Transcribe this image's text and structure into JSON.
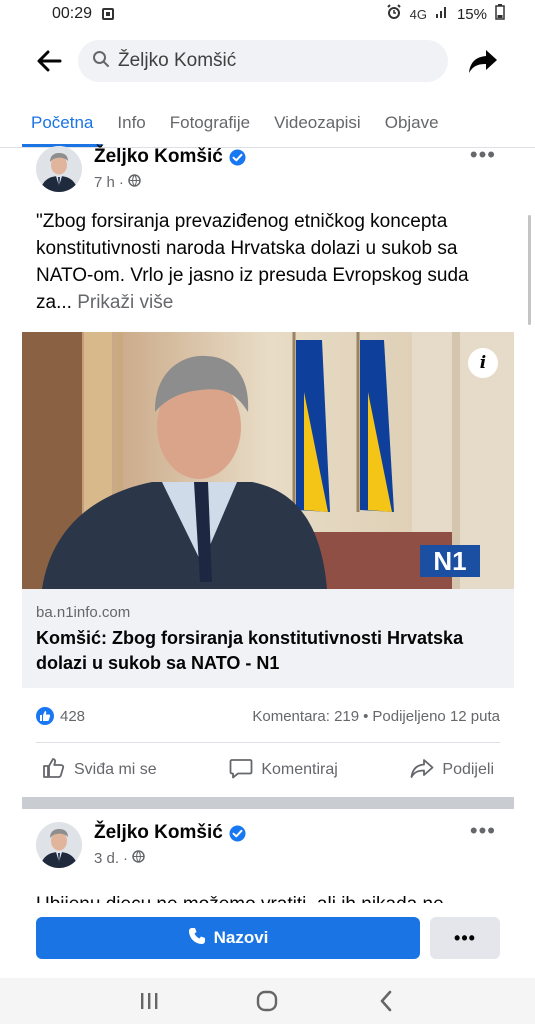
{
  "status_bar": {
    "time": "00:29",
    "network": "4G",
    "battery": "15%"
  },
  "top_bar": {
    "search_text": "Željko Komšić"
  },
  "tabs": [
    {
      "label": "Početna",
      "active": true
    },
    {
      "label": "Info",
      "active": false
    },
    {
      "label": "Fotografije",
      "active": false
    },
    {
      "label": "Videozapisi",
      "active": false
    },
    {
      "label": "Objave",
      "active": false
    }
  ],
  "post1": {
    "author": "Željko Komšić",
    "time": "7 h",
    "text": "\"Zbog forsiranja prevaziđenog etničkog koncepta konstitutivnosti naroda Hrvatska dolazi u sukob sa NATO-om. Vrlo je jasno iz presuda Evropskog suda za...",
    "see_more": "Prikaži više",
    "link": {
      "domain": "ba.n1info.com",
      "title": "Komšić: Zbog forsiranja konstitutivnosti Hrvatska dolazi u sukob sa NATO - N1",
      "logo_text": "N1"
    },
    "reactions_count": "428",
    "comments": "Komentara: 219",
    "separator": "•",
    "shares": "Podijeljeno 12 puta",
    "actions": {
      "like": "Sviđa mi se",
      "comment": "Komentiraj",
      "share": "Podijeli"
    }
  },
  "post2": {
    "author": "Željko Komšić",
    "time": "3 d.",
    "text_preview": "Ubijenu djecu ne možemo vratiti, ali ih nikada ne"
  },
  "cta": {
    "call_label": "Nazovi",
    "more_label": "•••"
  },
  "colors": {
    "accent": "#1b74e4",
    "secondary_text": "#65676b",
    "like_blue": "#1877f2"
  }
}
